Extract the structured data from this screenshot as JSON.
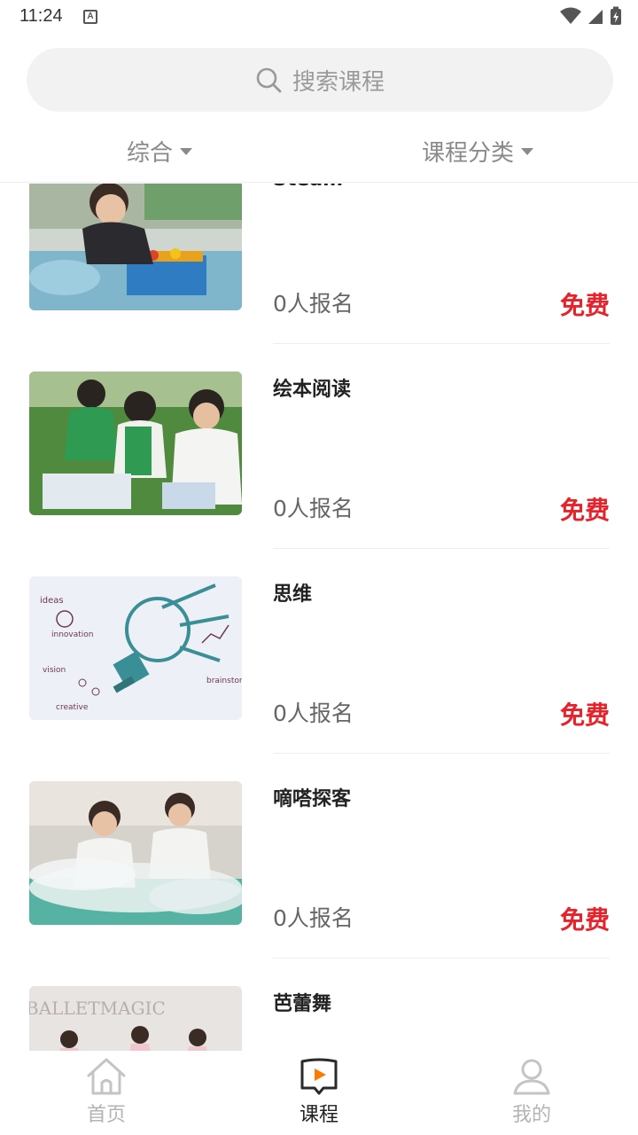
{
  "status_bar": {
    "time": "11:24",
    "notification_letter": "A"
  },
  "search": {
    "placeholder": "搜索课程"
  },
  "filters": {
    "left_label": "综合",
    "right_label": "课程分类"
  },
  "courses": [
    {
      "title": "Steam",
      "enroll_text": "0人报名",
      "price": "免费",
      "image": "child-building-blocks"
    },
    {
      "title": "绘本阅读",
      "enroll_text": "0人报名",
      "price": "免费",
      "image": "children-reading-picture-books"
    },
    {
      "title": "思维",
      "enroll_text": "0人报名",
      "price": "免费",
      "image": "lightbulb-sketch"
    },
    {
      "title": "嘀嗒探客",
      "enroll_text": "0人报名",
      "price": "免费",
      "image": "kids-science-fog"
    },
    {
      "title": "芭蕾舞",
      "enroll_text": "",
      "price": "",
      "image": "ballet-class"
    }
  ],
  "tabs": [
    {
      "label": "首页",
      "icon": "home-icon",
      "active": false
    },
    {
      "label": "课程",
      "icon": "course-book-icon",
      "active": true
    },
    {
      "label": "我的",
      "icon": "profile-icon",
      "active": false
    }
  ],
  "colors": {
    "price": "#e8222b",
    "accent": "#ff7a00",
    "inactive": "#b3b3b3"
  }
}
